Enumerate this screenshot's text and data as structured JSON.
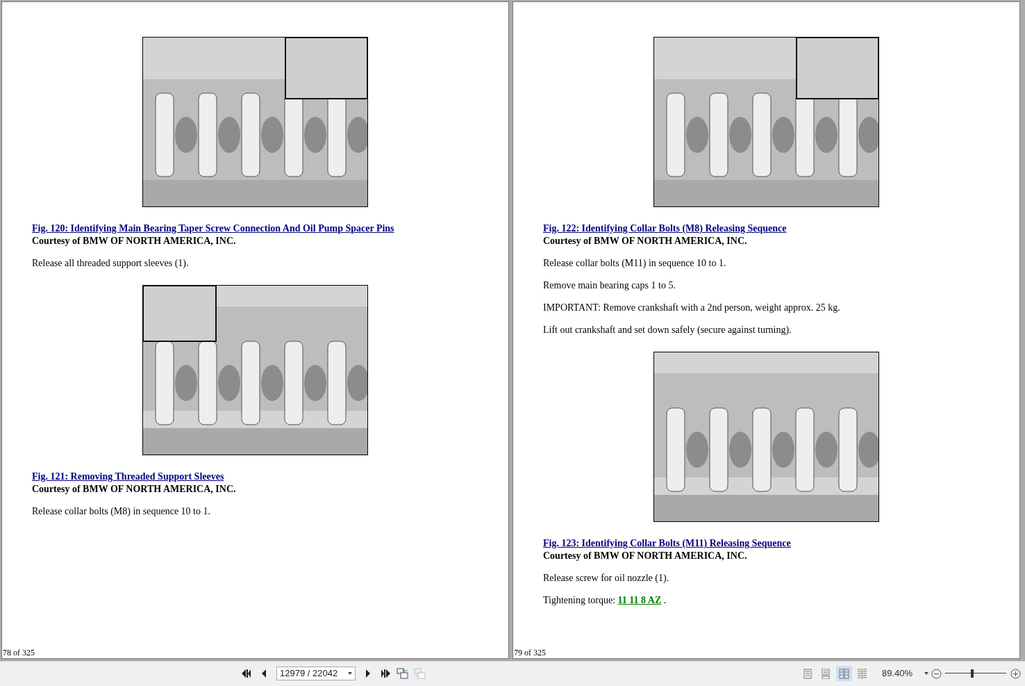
{
  "pages": [
    {
      "page_label": "78 of 325",
      "blocks": [
        {
          "kind": "figure"
        },
        {
          "kind": "caption",
          "title": "Fig. 120: Identifying Main Bearing Taper Screw Connection And Oil Pump Spacer Pins",
          "credit": "Courtesy of BMW OF NORTH AMERICA, INC."
        },
        {
          "kind": "paragraph",
          "text": "Release all threaded support sleeves (1)."
        },
        {
          "kind": "figure"
        },
        {
          "kind": "caption",
          "title": "Fig. 121: Removing Threaded Support Sleeves",
          "credit": "Courtesy of BMW OF NORTH AMERICA, INC."
        },
        {
          "kind": "paragraph",
          "text": "Release collar bolts (M8) in sequence 10 to 1."
        }
      ]
    },
    {
      "page_label": "79 of 325",
      "blocks": [
        {
          "kind": "figure"
        },
        {
          "kind": "caption",
          "title": "Fig. 122: Identifying Collar Bolts (M8) Releasing Sequence",
          "credit": "Courtesy of BMW OF NORTH AMERICA, INC."
        },
        {
          "kind": "paragraph",
          "text": "Release collar bolts (M11) in sequence 10 to 1."
        },
        {
          "kind": "paragraph",
          "text": "Remove main bearing caps 1 to 5."
        },
        {
          "kind": "paragraph",
          "text": "IMPORTANT: Remove crankshaft with a 2nd person, weight approx. 25 kg."
        },
        {
          "kind": "paragraph",
          "text": "Lift out crankshaft and set down safely (secure against turning)."
        },
        {
          "kind": "figure"
        },
        {
          "kind": "caption",
          "title": "Fig. 123: Identifying Collar Bolts (M11) Releasing Sequence",
          "credit": "Courtesy of BMW OF NORTH AMERICA, INC."
        },
        {
          "kind": "paragraph",
          "text": "Release screw for oil nozzle (1)."
        },
        {
          "kind": "reference",
          "text": "Tightening torque:",
          "link": "11 11 8 AZ",
          "after": "."
        }
      ]
    }
  ],
  "toolbar": {
    "page_field": "12979 / 22042",
    "views": [
      {
        "selected": false
      },
      {
        "selected": false
      },
      {
        "selected": true
      },
      {
        "selected": false
      }
    ],
    "zoom": "89.40%",
    "zoom_slider": {
      "level": 0.44
    }
  }
}
